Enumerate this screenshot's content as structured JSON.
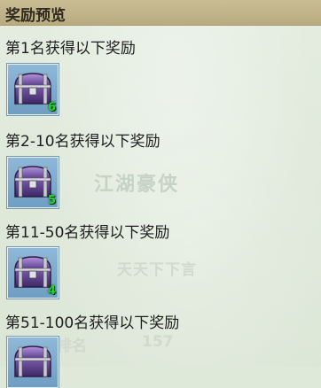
{
  "header": {
    "title": "奖励预览"
  },
  "tiers": [
    {
      "label": "第1名获得以下奖励",
      "item_icon": "purple-treasure-chest",
      "count": "6"
    },
    {
      "label": "第2-10名获得以下奖励",
      "item_icon": "purple-treasure-chest",
      "count": "5"
    },
    {
      "label": "第11-50名获得以下奖励",
      "item_icon": "purple-treasure-chest",
      "count": "4"
    },
    {
      "label": "第51-100名获得以下奖励",
      "item_icon": "purple-treasure-chest",
      "count": ""
    }
  ],
  "background_text": {
    "title": "江湖豪侠",
    "subtitle": "天天下下言",
    "rank_label": "排名",
    "rank_value": "157"
  },
  "colors": {
    "header_bg": "#c9bd95",
    "panel_bg": "#dfe9da",
    "slot_bg": "#7fa9cf",
    "count_text": "#1fd72a",
    "chest_purple": "#6a4c9c"
  }
}
